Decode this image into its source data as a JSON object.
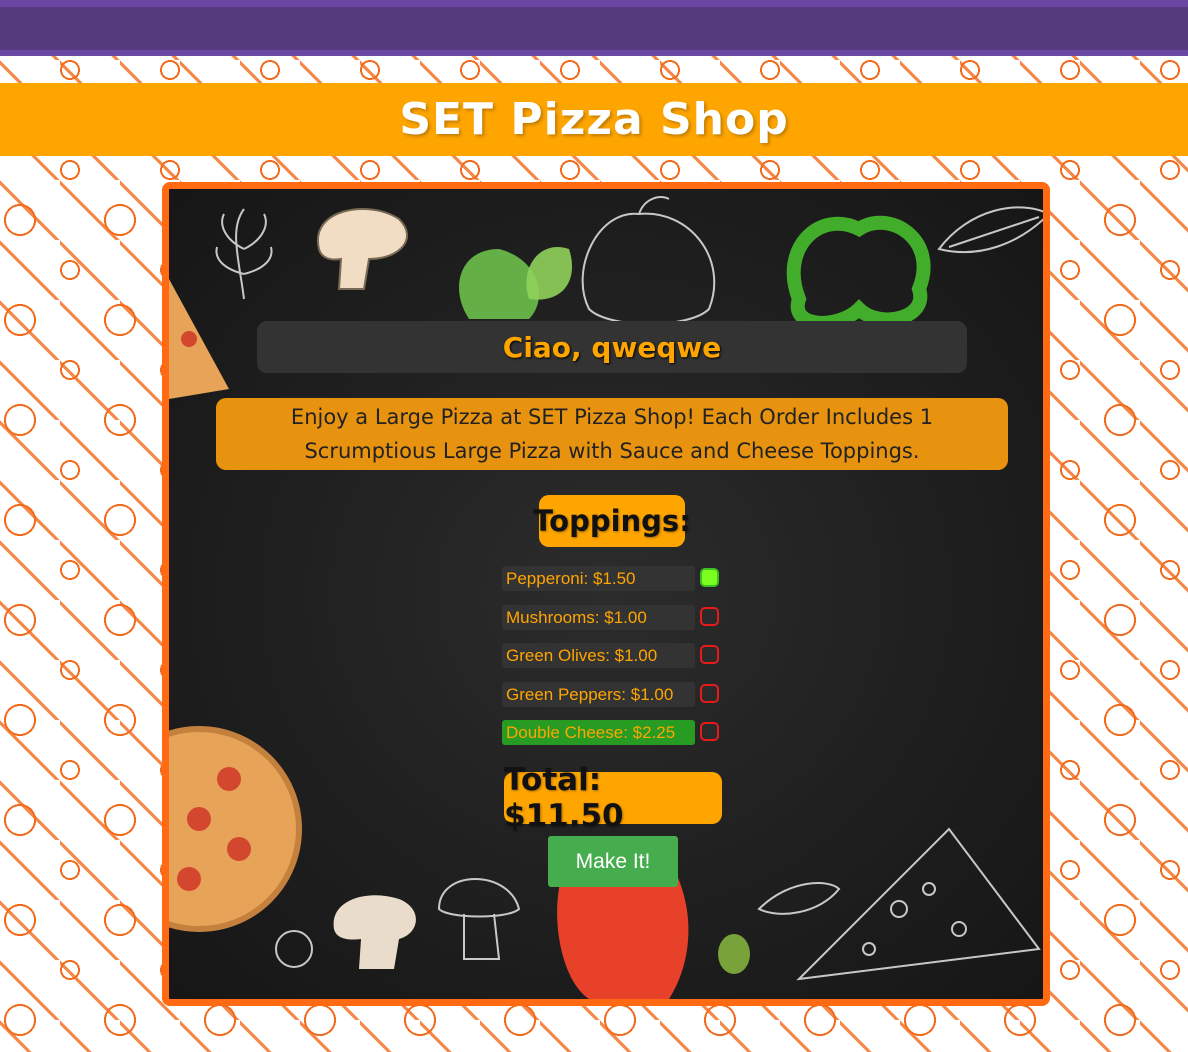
{
  "header": {
    "title": "SET Pizza Shop"
  },
  "greeting": "Ciao, qweqwe",
  "description": "Enjoy a Large Pizza at SET Pizza Shop! Each Order Includes 1 Scrumptious Large Pizza with Sauce and Cheese Toppings.",
  "toppings": {
    "title": "Toppings:",
    "items": [
      {
        "label": "Pepperoni: $1.50",
        "checked": true,
        "highlight": false
      },
      {
        "label": "Mushrooms: $1.00",
        "checked": false,
        "highlight": false
      },
      {
        "label": "Green Olives: $1.00",
        "checked": false,
        "highlight": false
      },
      {
        "label": "Green Peppers: $1.00",
        "checked": false,
        "highlight": false
      },
      {
        "label": "Double Cheese: $2.25",
        "checked": false,
        "highlight": true
      }
    ]
  },
  "total": "Total: $11.50",
  "make_button": "Make It!",
  "colors": {
    "header_band": "#ffa500",
    "topbar": "#553a7d",
    "board_border": "#ff6a13",
    "button": "#46ad4e"
  }
}
